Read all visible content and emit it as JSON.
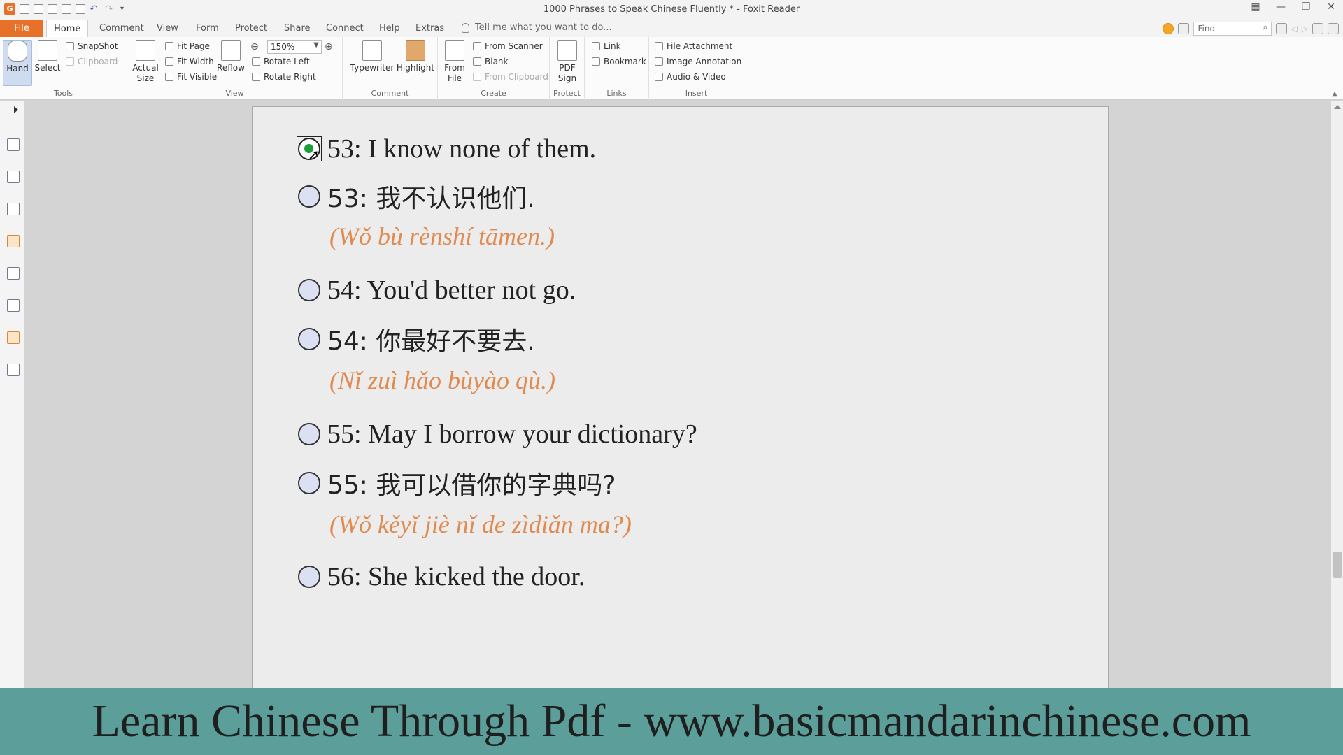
{
  "window": {
    "title": "1000 Phrases to Speak Chinese Fluently * - Foxit Reader"
  },
  "menu": {
    "tabs": [
      "File",
      "Home",
      "Comment",
      "View",
      "Form",
      "Protect",
      "Share",
      "Connect",
      "Help",
      "Extras"
    ],
    "active_tab": "Home",
    "tell_me": "Tell me what you want to do...",
    "find_placeholder": "Find"
  },
  "ribbon": {
    "tools": {
      "label": "Tools",
      "hand": "Hand",
      "select": "Select",
      "snapshot": "SnapShot",
      "clipboard": "Clipboard"
    },
    "view": {
      "label": "View",
      "actual_size_1": "Actual",
      "actual_size_2": "Size",
      "fit_page": "Fit Page",
      "fit_width": "Fit Width",
      "fit_visible": "Fit Visible",
      "reflow": "Reflow",
      "zoom": "150%",
      "rotate_left": "Rotate Left",
      "rotate_right": "Rotate Right"
    },
    "comment": {
      "label": "Comment",
      "typewriter": "Typewriter",
      "highlight": "Highlight"
    },
    "create": {
      "label": "Create",
      "from_file_1": "From",
      "from_file_2": "File",
      "from_scanner": "From Scanner",
      "blank": "Blank",
      "from_clipboard": "From Clipboard"
    },
    "protect": {
      "label": "Protect",
      "pdf_sign_1": "PDF",
      "pdf_sign_2": "Sign"
    },
    "links": {
      "label": "Links",
      "link": "Link",
      "bookmark": "Bookmark"
    },
    "insert": {
      "label": "Insert",
      "file_attachment": "File Attachment",
      "image_annotation": "Image Annotation",
      "audio_video": "Audio & Video"
    }
  },
  "document": {
    "entries": [
      {
        "text": "53: I know none of them.",
        "checked": true
      },
      {
        "text": "53: 我不认识他们.",
        "checked": false
      },
      {
        "pinyin": "(Wǒ bù rènshí tāmen.)"
      },
      {
        "text": "54: You'd better not go.",
        "checked": false
      },
      {
        "text": "54: 你最好不要去.",
        "checked": false
      },
      {
        "pinyin": "(Nǐ zuì hǎo bùyào qù.)"
      },
      {
        "text": "55: May I borrow your dictionary?",
        "checked": false
      },
      {
        "text": "55: 我可以借你的字典吗?",
        "checked": false
      },
      {
        "pinyin": "(Wǒ kěyǐ jiè nǐ de zìdiǎn ma?)"
      },
      {
        "text": "56: She kicked the door.",
        "checked": false
      }
    ]
  },
  "banner": {
    "text": "Learn Chinese Through Pdf - www.basicmandarinchinese.com"
  },
  "colors": {
    "accent": "#e8712a",
    "pinyin": "#e08a50",
    "banner": "#5c9f9a",
    "radio_checked": "#1b9e3a"
  }
}
